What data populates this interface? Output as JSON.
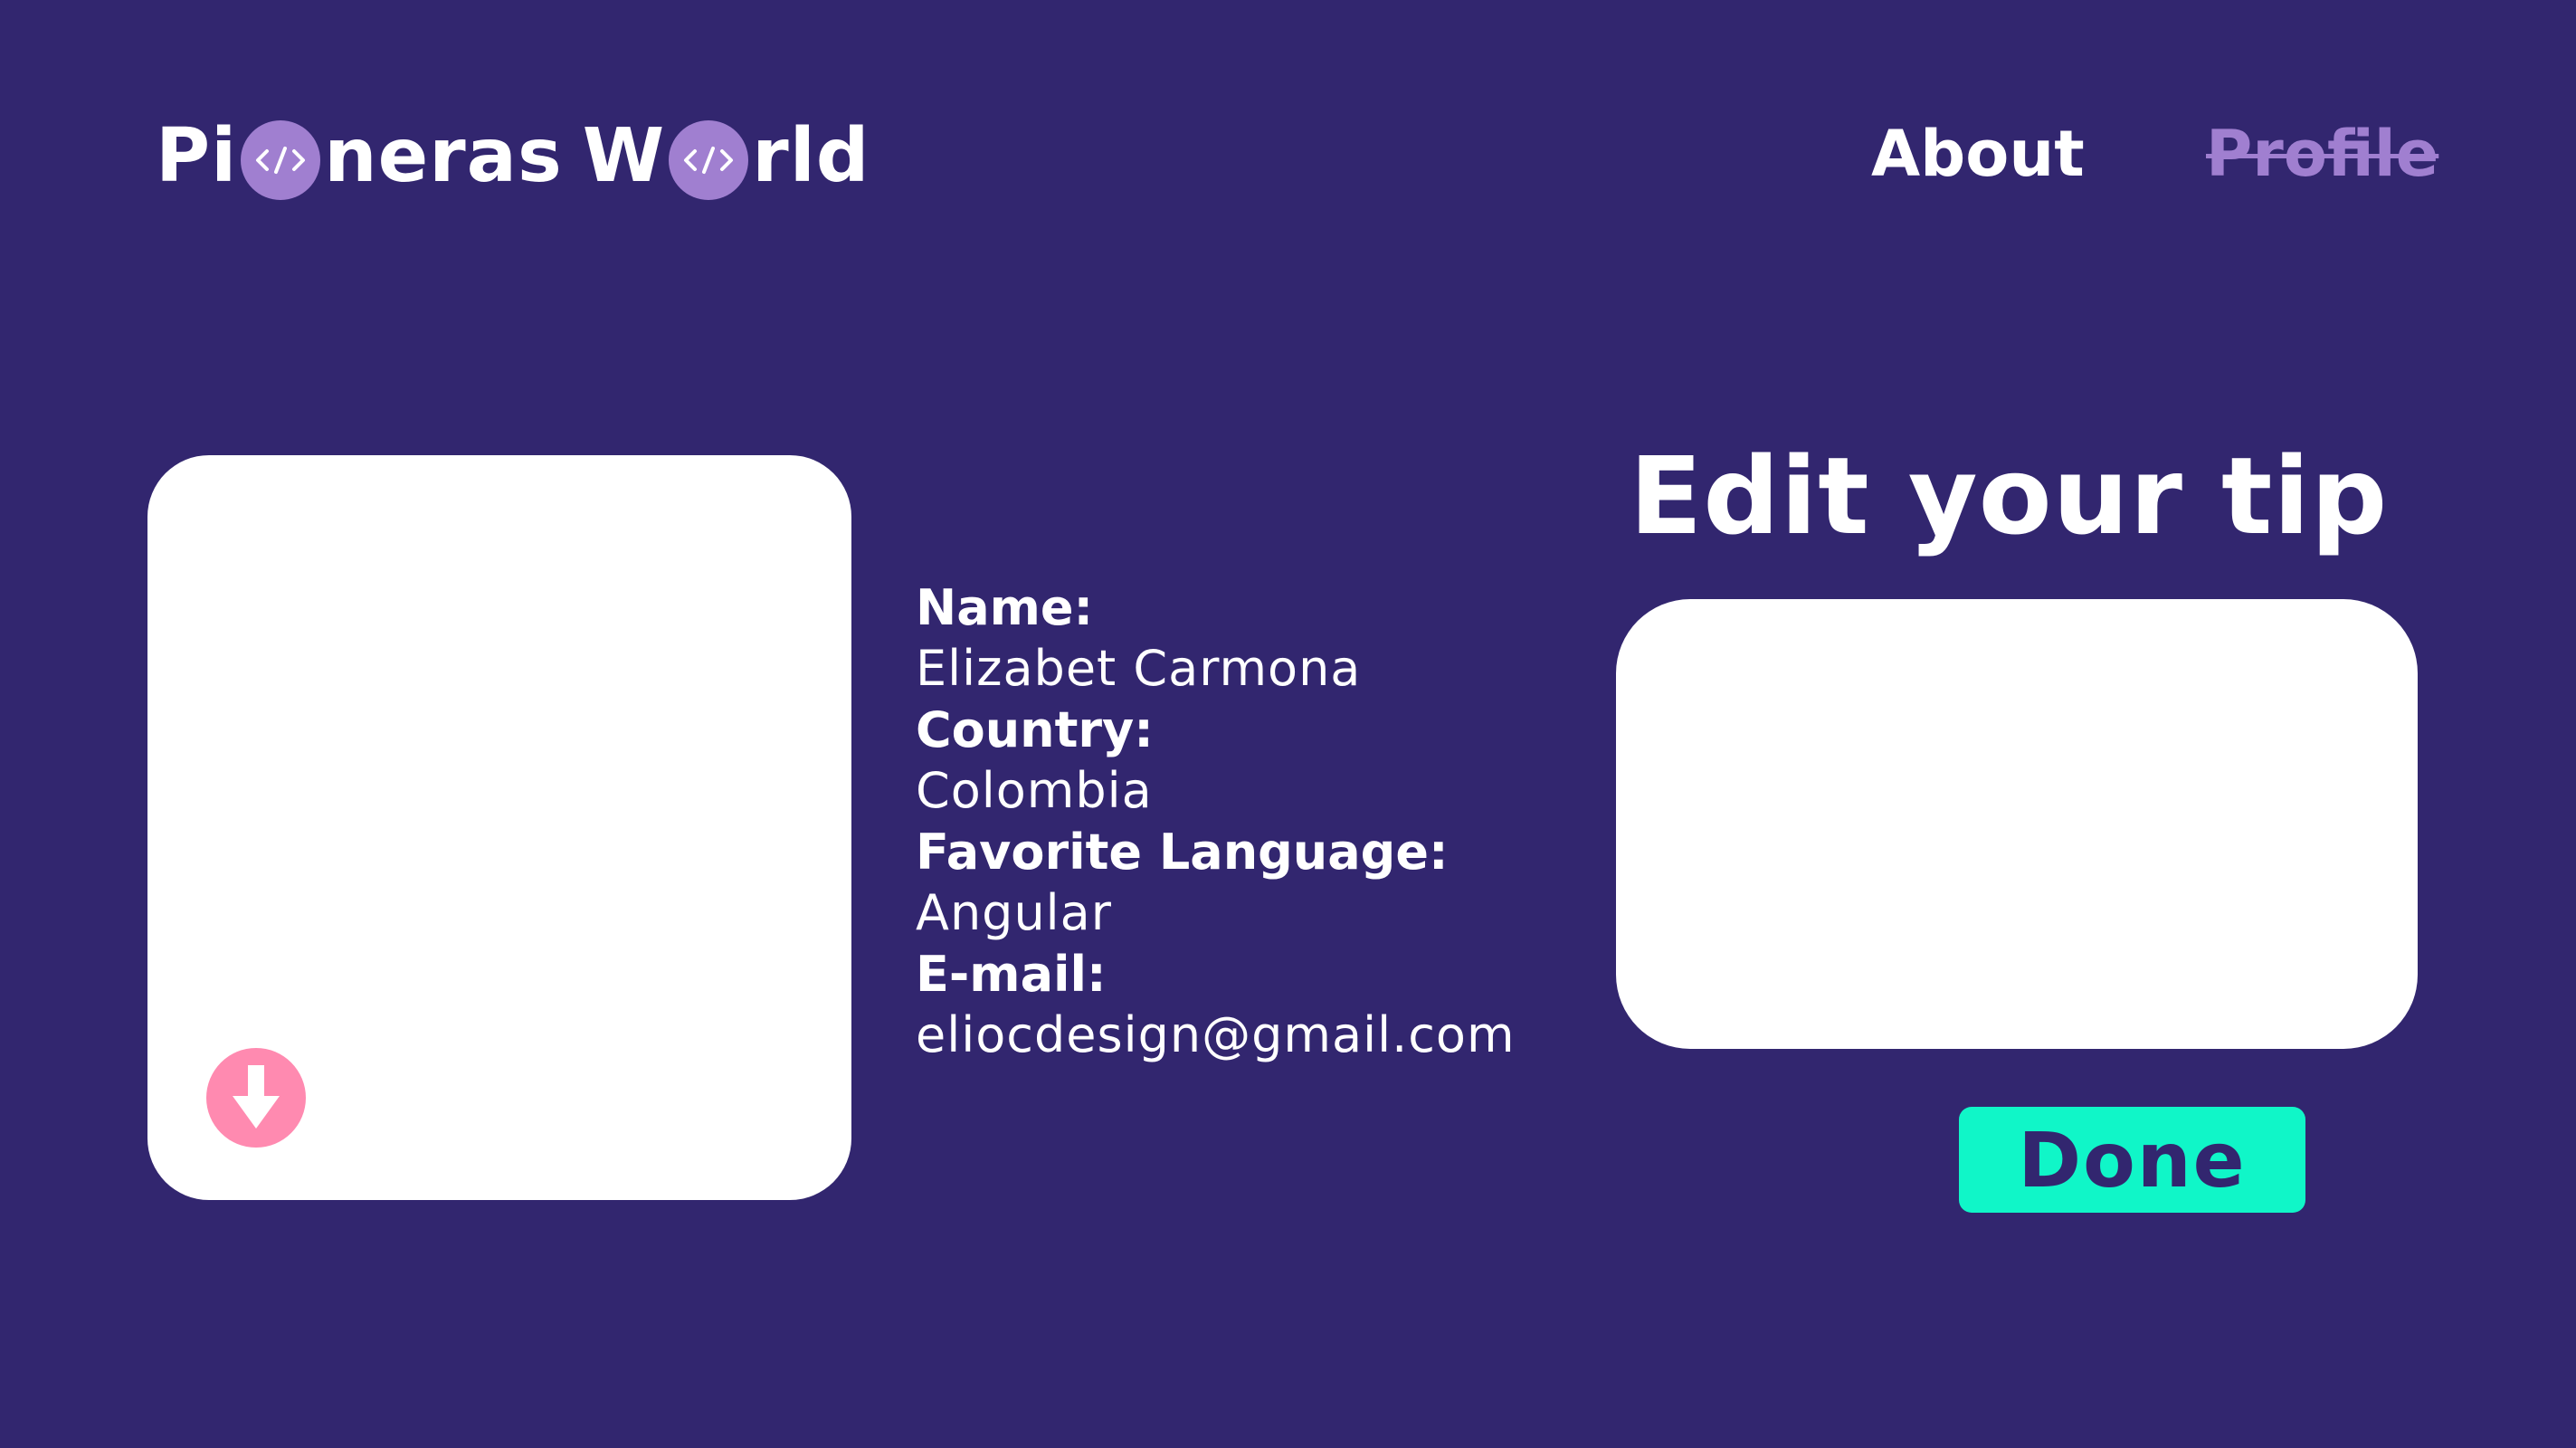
{
  "colors": {
    "background": "#32266f",
    "accent_purple": "#a07fd0",
    "download_pink": "#ff8ab0",
    "done_green": "#10f6c8",
    "card_white": "#ffffff"
  },
  "header": {
    "logo": {
      "part1": "Pi",
      "part2": "neras",
      "part3": "W",
      "part4": "rld",
      "o_icon": "code-brackets-icon",
      "o_icon_text": "</>"
    },
    "nav": {
      "about": "About",
      "profile": "Profile"
    }
  },
  "photo_card": {
    "download_icon": "arrow-down-icon"
  },
  "profile": {
    "name_label": "Name:",
    "name_value": "Elizabet Carmona",
    "country_label": "Country:",
    "country_value": "Colombia",
    "language_label": "Favorite Language:",
    "language_value": "Angular",
    "email_label": "E-mail:",
    "email_value": "eliocdesign@gmail.com"
  },
  "tip": {
    "title": "Edit your tip",
    "value": "",
    "done_label": "Done"
  }
}
